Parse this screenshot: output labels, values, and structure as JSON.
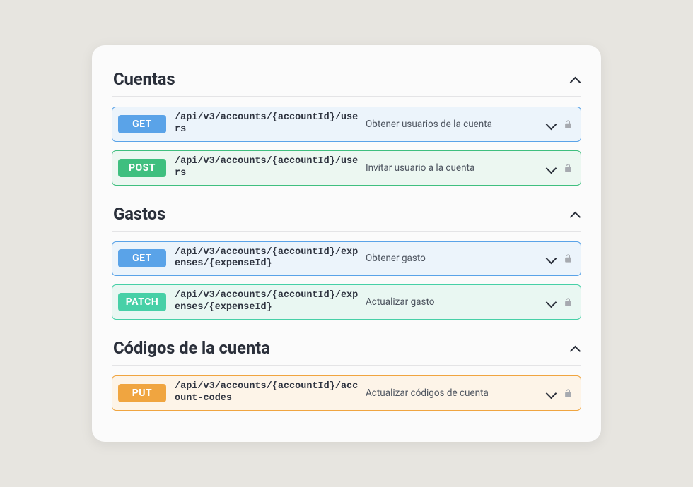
{
  "sections": [
    {
      "title": "Cuentas",
      "ops": [
        {
          "method": "GET",
          "path": "/api/v3/accounts/{accountId}/users",
          "summary": "Obtener usuarios de la cuenta"
        },
        {
          "method": "POST",
          "path": "/api/v3/accounts/{accountId}/users",
          "summary": "Invitar usuario a la cuenta"
        }
      ]
    },
    {
      "title": "Gastos",
      "ops": [
        {
          "method": "GET",
          "path": "/api/v3/accounts/{accountId}/expenses/{expenseId}",
          "summary": "Obtener gasto"
        },
        {
          "method": "PATCH",
          "path": "/api/v3/accounts/{accountId}/expenses/{expenseId}",
          "summary": "Actualizar gasto"
        }
      ]
    },
    {
      "title": "Códigos de la cuenta",
      "ops": [
        {
          "method": "PUT",
          "path": "/api/v3/accounts/{accountId}/account-codes",
          "summary": "Actualizar códigos de cuenta"
        }
      ]
    }
  ],
  "method_styles": {
    "GET": {
      "row": "op-get",
      "badge": "badge-get"
    },
    "POST": {
      "row": "op-post",
      "badge": "badge-post"
    },
    "PATCH": {
      "row": "op-patch",
      "badge": "badge-patch"
    },
    "PUT": {
      "row": "op-put",
      "badge": "badge-put"
    }
  }
}
